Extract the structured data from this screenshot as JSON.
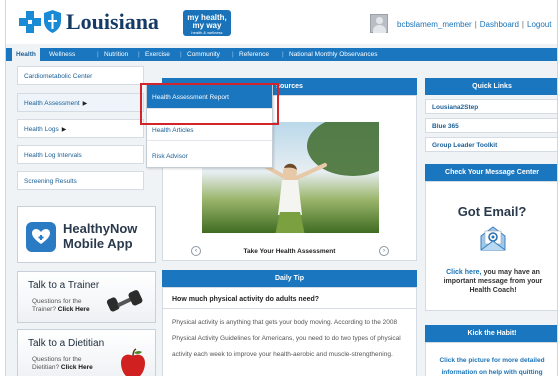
{
  "header": {
    "brand": "Louisiana",
    "badge_line1": "my health,",
    "badge_line2": "my way",
    "badge_line3": "health & wellness",
    "username": "bcbslamem_member",
    "dashboard_link": "Dashboard",
    "logout_link": "Logout",
    "separator": "|"
  },
  "nav": {
    "items": [
      "Health",
      "Wellness",
      "Nutrition",
      "Exercise",
      "Community",
      "Reference",
      "National Monthly Observances"
    ],
    "separator": "|"
  },
  "left_menu": {
    "items": [
      "Cardiometabolic Center",
      "Health Assessment",
      "Health Logs",
      "Health Log Intervals",
      "Screening Results"
    ],
    "arrow": "▶"
  },
  "dropdown": {
    "items": [
      "Health Assessment Report",
      "Health Articles",
      "Risk Advisor"
    ]
  },
  "resources": {
    "header_visible": "sources",
    "caption": "Take Your Health Assessment",
    "prev": "‹",
    "next": "›"
  },
  "healthynow": {
    "line1": "HealthyNow",
    "line2": "Mobile App"
  },
  "trainer": {
    "title": "Talk to a Trainer",
    "text": "Questions for the Trainer?",
    "cta": "Click Here"
  },
  "dietitian": {
    "title": "Talk to a Dietitian",
    "text": "Questions for the Dietitian?",
    "cta": "Click Here"
  },
  "daily_tip": {
    "header": "Daily Tip",
    "question": "How much physical activity do adults need?",
    "body": "Physical activity is anything that gets your body moving. According to the 2008 Physical Activity Guidelines for Americans, you need to do two types of physical activity each week to improve your health-aerobic and muscle-strengthening."
  },
  "quick_links": {
    "header": "Quick Links",
    "items": [
      "Lousiana2Step",
      "Blue 365",
      "Group Leader Toolkit"
    ]
  },
  "message_center": {
    "header": "Check Your Message Center",
    "title": "Got Email?",
    "link": "Click here,",
    "text": "you may have an important message from your Health Coach!"
  },
  "kick_habit": {
    "header": "Kick the Habit!",
    "text": "Click the picture for more detailed information on help with quitting"
  },
  "colors": {
    "primary_blue": "#1a76bf",
    "dark_navy": "#163a66",
    "link_blue": "#1a73b8",
    "highlight_red": "#d4242b",
    "apple_red": "#d0201f"
  }
}
